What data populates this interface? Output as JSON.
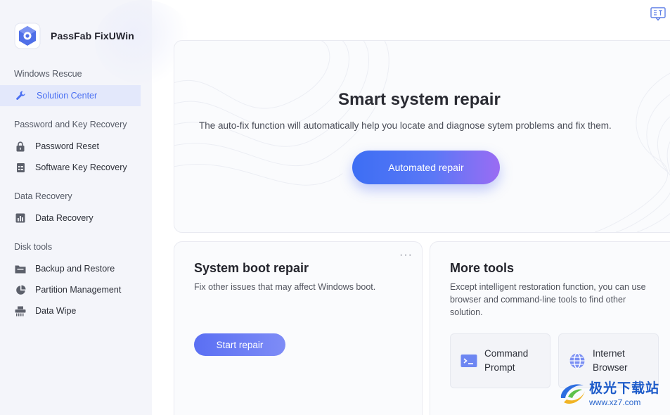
{
  "app": {
    "name": "PassFab FixUWin"
  },
  "sidebar": {
    "sections": [
      {
        "title": "Windows Rescue",
        "items": [
          {
            "label": "Solution Center",
            "icon": "wrench-icon",
            "active": true
          }
        ]
      },
      {
        "title": "Password and Key Recovery",
        "items": [
          {
            "label": "Password Reset",
            "icon": "lock-icon"
          },
          {
            "label": "Software Key Recovery",
            "icon": "key-doc-icon"
          }
        ]
      },
      {
        "title": "Data Recovery",
        "items": [
          {
            "label": "Data Recovery",
            "icon": "bar-chart-icon"
          }
        ]
      },
      {
        "title": "Disk tools",
        "items": [
          {
            "label": "Backup and Restore",
            "icon": "folder-icon"
          },
          {
            "label": "Partition Management",
            "icon": "pie-icon"
          },
          {
            "label": "Data Wipe",
            "icon": "shredder-icon"
          }
        ]
      }
    ]
  },
  "hero": {
    "title": "Smart system repair",
    "description": "The auto-fix function will automatically help you locate and diagnose sytem problems and fix them.",
    "button": "Automated repair"
  },
  "boot": {
    "title": "System boot repair",
    "description": "Fix other issues that may affect Windows boot.",
    "button": "Start repair",
    "menu": "···"
  },
  "more_tools": {
    "title": "More tools",
    "description": "Except intelligent restoration function, you can use browser and command-line tools to find other solution.",
    "tools": [
      {
        "line1": "Command",
        "line2": "Prompt",
        "icon": "terminal-icon"
      },
      {
        "line1": "Internet",
        "line2": "Browser",
        "icon": "globe-icon"
      }
    ]
  },
  "watermark": {
    "cn": "极光下载站",
    "url": "www.xz7.com"
  },
  "colors": {
    "accent": "#4a6ff2",
    "active_bg": "#e3e8fb",
    "sidebar_bg": "#f4f5fa"
  }
}
